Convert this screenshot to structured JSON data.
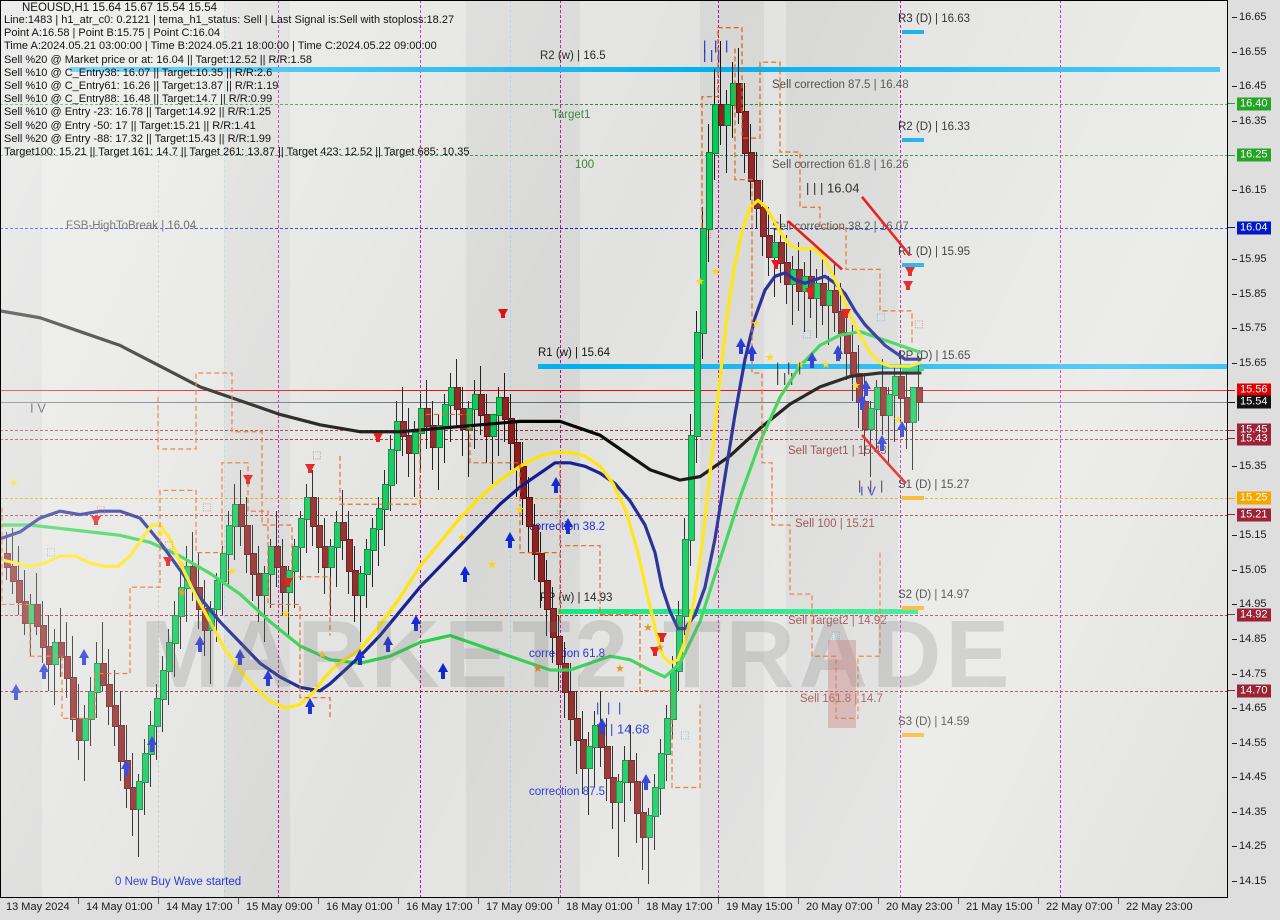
{
  "window": {
    "symbol_line": "NEOUSD,H1  15.64 15.67 15.54 15.54",
    "info_lines": [
      "Line:1483 | h1_atr_c0: 0.2121 | tema_h1_status: Sell | Last Signal is:Sell with stoploss:18.27",
      "Point A:16.58 |  Point B:15.75 |  Point C:16.04",
      "Time A:2024.05.21 03:00:00 |  Time B:2024.05.21 18:00:00 |  Time C:2024.05.22 09:00:00",
      "Sell %20 @ Market price or at: 16.04 ||  Target:12.52 ||  R/R:1.58",
      "Sell %10 @ C_Entry38: 16.07 ||  Target:10.35 ||  R/R:2.6",
      "Sell %10 @ C_Entry61: 16.26 ||  Target:13.87 ||  R/R:1.19",
      "Sell %10 @ C_Entry88: 16.48 ||  Target:14.7 ||  R/R:0.99",
      "Sell %10 @ Entry -23: 16.78 ||  Target:14.92 ||  R/R:1.25",
      "Sell %20 @ Entry -50: 17 ||  Target:15.21 ||  R/R:1.41",
      "Sell %20 @ Entry -88: 17.32 ||  Target:15.43 ||  R/R:1.99",
      "Target100: 15.21 ||  Target 161: 14.7 ||  Target 261: 13.87 ||  Target 423: 12.52 ||  Target 685: 10.35"
    ]
  },
  "watermark": {
    "text": "MARKET2 TRADE"
  },
  "chart_data": {
    "type": "candlestick",
    "symbol": "NEOUSD",
    "timeframe": "H1",
    "ohlc_quote": {
      "open": "15.64",
      "high": "15.67",
      "low": "15.54",
      "close": "15.54"
    },
    "ylim": [
      14.1,
      16.7
    ],
    "ylabel": "",
    "xlabel": "",
    "grid": true,
    "y_ticks": [
      "16.65",
      "16.55",
      "16.45",
      "16.35",
      "16.15",
      "15.95",
      "15.85",
      "15.75",
      "15.65",
      "15.35",
      "15.15",
      "15.05",
      "14.95",
      "14.85",
      "14.75",
      "14.65",
      "14.55",
      "14.45",
      "14.35",
      "14.25",
      "14.15"
    ],
    "y_badges": [
      {
        "value": "16.40",
        "bg": "#22a522",
        "fg": "#ffffff"
      },
      {
        "value": "16.25",
        "bg": "#22a522",
        "fg": "#ffffff"
      },
      {
        "value": "16.04",
        "bg": "#0018c8",
        "fg": "#ffffff"
      },
      {
        "value": "15.56",
        "bg": "#e00000",
        "fg": "#ffffff"
      },
      {
        "value": "15.54",
        "bg": "#111111",
        "fg": "#ffffff"
      },
      {
        "value": "15.45",
        "bg": "#9b2335",
        "fg": "#ffffff"
      },
      {
        "value": "15.43",
        "bg": "#9b2335",
        "fg": "#ffffff"
      },
      {
        "value": "15.25",
        "bg": "#f5a700",
        "fg": "#ffffff"
      },
      {
        "value": "15.21",
        "bg": "#9b2335",
        "fg": "#ffffff"
      },
      {
        "value": "14.92",
        "bg": "#9b2335",
        "fg": "#ffffff"
      },
      {
        "value": "14.70",
        "bg": "#9b2335",
        "fg": "#ffffff"
      }
    ],
    "x_labels": [
      "13 May 2024",
      "14 May 01:00",
      "14 May 17:00",
      "15 May 09:00",
      "16 May 01:00",
      "16 May 17:00",
      "17 May 09:00",
      "18 May 01:00",
      "18 May 17:00",
      "19 May 15:00",
      "20 May 07:00",
      "20 May 23:00",
      "21 May 15:00",
      "22 May 07:00",
      "22 May 23:00"
    ],
    "pivot_levels_right": [
      {
        "label": "R3 (D) |",
        "value": "16.63",
        "color": "#00a8e8"
      },
      {
        "label": "R2 (D) |",
        "value": "16.33",
        "color": "#00a8e8"
      },
      {
        "label": "R1 (D) |",
        "value": "15.95",
        "color": "#00a8e8"
      },
      {
        "label": "PP (D) |",
        "value": "15.65",
        "color": "#00d26a"
      },
      {
        "label": "S1 (D) |",
        "value": "15.27",
        "color": "#f5a700"
      },
      {
        "label": "S2 (D) |",
        "value": "14.97",
        "color": "#f5a700"
      },
      {
        "label": "S3 (D) |",
        "value": "14.59",
        "color": "#f5a700"
      }
    ],
    "weekly_levels": [
      {
        "label": "R2 (w) | 16.5",
        "value": 16.5,
        "color": "#00b0f0"
      },
      {
        "label": "R1 (w) | 15.64",
        "value": 15.64,
        "color": "#00b0f0"
      },
      {
        "label": "PP (w) | 14.93",
        "value": 14.93,
        "color": "#00e676"
      }
    ],
    "annotations": [
      {
        "text": "FSB-HighToBreak | 16.04",
        "color": "#222222"
      },
      {
        "text": "Target1",
        "color": "#2e7d32"
      },
      {
        "text": "100",
        "color": "#2e7d32"
      },
      {
        "text": "Sell correction 87.5 | 16.48",
        "color": "#444444"
      },
      {
        "text": "Sell correction 61.8 | 16.26",
        "color": "#444444"
      },
      {
        "text": "Sell correction 38.2 | 16.07",
        "color": "#444444"
      },
      {
        "text": "| | | 16.04",
        "color": "#111111"
      },
      {
        "text": "Sell Target1 | 15.43",
        "color": "#8b2c2c"
      },
      {
        "text": "Sell 100 | 15.21",
        "color": "#8b2c2c"
      },
      {
        "text": "Sell Target2 | 14.92",
        "color": "#8b2c2c"
      },
      {
        "text": "Sell 161.8 | 14.7",
        "color": "#8b2c2c"
      },
      {
        "text": "correction 38.2",
        "color": "#1024d0"
      },
      {
        "text": "correction 61.8",
        "color": "#1024d0"
      },
      {
        "text": "correction 87.5",
        "color": "#1024d0"
      },
      {
        "text": "| | | 14.68",
        "color": "#1024d0"
      },
      {
        "text": "0 New Buy Wave started",
        "color": "#1024d0"
      },
      {
        "text": "I V",
        "color": "#333333"
      },
      {
        "text": "I V",
        "color": "#1024d0"
      },
      {
        "text": "| | |",
        "color": "#1024d0"
      },
      {
        "text": "| | |",
        "color": "#111111"
      }
    ],
    "series": [
      {
        "name": "MA-yellow",
        "color": "#ffe400"
      },
      {
        "name": "MA-navy",
        "color": "#101a8c"
      },
      {
        "name": "MA-green",
        "color": "#27cf46"
      },
      {
        "name": "MA-black",
        "color": "#000000"
      },
      {
        "name": "fractal-band",
        "color": "#e06010"
      }
    ]
  }
}
